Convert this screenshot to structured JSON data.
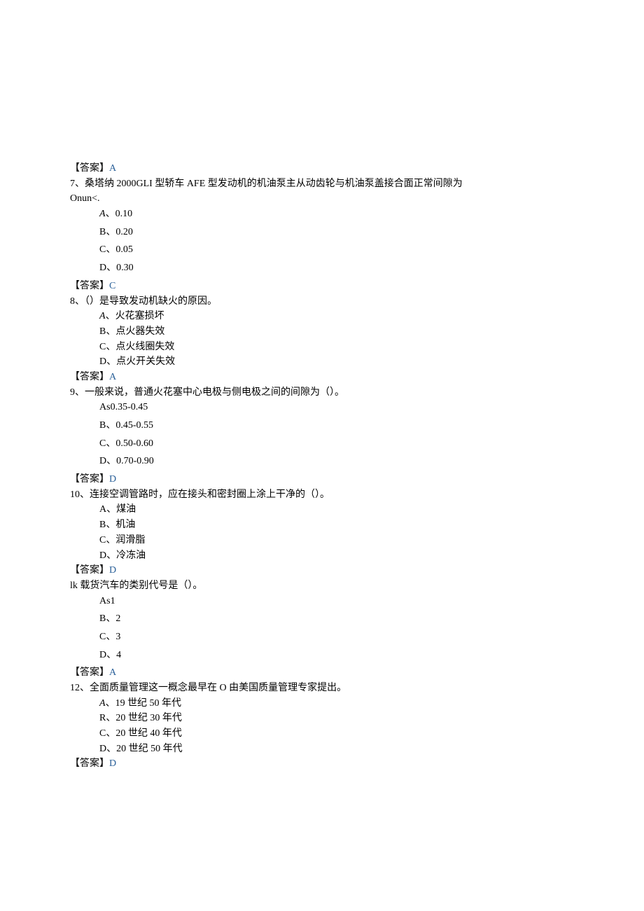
{
  "labels": {
    "answer": "【答案】"
  },
  "items": [
    {
      "answer_only": true,
      "answer": "A"
    },
    {
      "number": "7、",
      "stem_lines": [
        "桑塔纳 2000GLI 型轿车 AFE 型发动机的机油泵主从动齿轮与机油泵盖接合面正常间隙为",
        "Onun<."
      ],
      "stem_indented": false,
      "options": [
        {
          "label": "A、",
          "text": "0.10",
          "italicA": true,
          "spaced": true
        },
        {
          "label": "B、",
          "text": "0.20",
          "spaced": true
        },
        {
          "label": "C、",
          "text": "0.05",
          "spaced": true
        },
        {
          "label": "D、",
          "text": "0.30",
          "spaced": true
        }
      ],
      "answer": "C"
    },
    {
      "number": "8、",
      "stem_lines": [
        "（）是导致发动机缺火的原因。"
      ],
      "stem_indented": false,
      "options": [
        {
          "label": "A、",
          "text": "火花塞损坏",
          "italicA": true
        },
        {
          "label": "B、",
          "text": "点火器失效"
        },
        {
          "label": "C、",
          "text": "点火线圈失效"
        },
        {
          "label": "D、",
          "text": "点火开关失效"
        }
      ],
      "answer": "A"
    },
    {
      "number": "9、",
      "stem_lines": [
        "一般来说，普通火花塞中心电极与侧电极之间的间隙为（）。"
      ],
      "options": [
        {
          "label": "As",
          "text": "0.35-0.45",
          "spaced": true
        },
        {
          "label": "B、",
          "text": "0.45-0.55",
          "spaced": true
        },
        {
          "label": "C、",
          "text": "0.50-0.60",
          "spaced": true
        },
        {
          "label": "D、",
          "text": "0.70-0.90",
          "spaced": true
        }
      ],
      "answer": "D"
    },
    {
      "number": "10、",
      "stem_lines": [
        "连接空调管路时，应在接头和密封圈上涂上干净的（）。"
      ],
      "options": [
        {
          "label": "A、",
          "text": "煤油"
        },
        {
          "label": "B、",
          "text": "机油"
        },
        {
          "label": "C、",
          "text": "润滑脂"
        },
        {
          "label": "D、",
          "text": "冷冻油"
        }
      ],
      "answer": "D"
    },
    {
      "number": "lk ",
      "stem_lines": [
        "载货汽车的类别代号是（）。"
      ],
      "inline_number": true,
      "options": [
        {
          "label": "As",
          "text": "1",
          "spaced": true
        },
        {
          "label": "B、",
          "text": "2",
          "spaced": true
        },
        {
          "label": "C、",
          "text": "3",
          "spaced": true
        },
        {
          "label": "D、",
          "text": "4",
          "spaced": true
        }
      ],
      "answer": "A"
    },
    {
      "number": "12、",
      "stem_lines": [
        "全面质量管理这一概念最早在 O 由美国质量管理专家提出。"
      ],
      "options": [
        {
          "label": "A、",
          "text": "19 世纪 50 年代",
          "italicA": true
        },
        {
          "label": "R、",
          "text": "20 世纪 30 年代"
        },
        {
          "label": "C、",
          "text": "20 世纪 40 年代"
        },
        {
          "label": "D、",
          "text": "20 世纪 50 年代"
        }
      ],
      "answer": "D"
    }
  ]
}
